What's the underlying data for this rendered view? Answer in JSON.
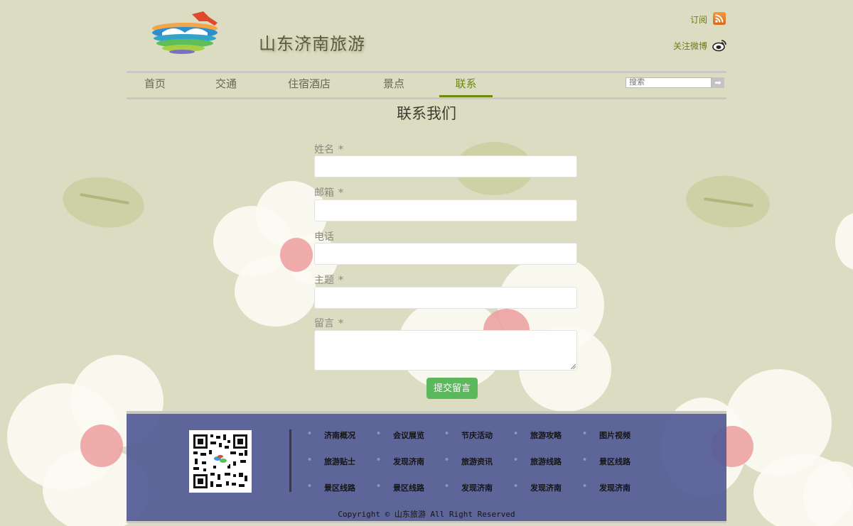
{
  "header": {
    "site_title": "山东济南旅游",
    "subscribe": "订阅",
    "follow_weibo": "关注微博",
    "logo_icon": "jinan-city-logo-icon",
    "rss_icon": "rss-icon",
    "weibo_icon": "weibo-icon"
  },
  "nav": {
    "items": [
      {
        "label": "首页",
        "active": false
      },
      {
        "label": "交通",
        "active": false
      },
      {
        "label": "住宿酒店",
        "active": false
      },
      {
        "label": "景点",
        "active": false
      },
      {
        "label": "联系",
        "active": true
      }
    ],
    "search_placeholder": "搜索",
    "search_button": "➡"
  },
  "form": {
    "title": "联系我们",
    "fields": [
      {
        "label": "姓名",
        "required": "*",
        "value": ""
      },
      {
        "label": "邮箱",
        "required": "*",
        "value": ""
      },
      {
        "label": "电话",
        "required": "",
        "value": ""
      },
      {
        "label": "主题",
        "required": "*",
        "value": ""
      },
      {
        "label": "留言",
        "required": "*",
        "value": ""
      }
    ],
    "submit": "提交留言"
  },
  "footer": {
    "links": [
      [
        "济南概况",
        "会议展览",
        "节庆活动",
        "旅游攻略",
        "图片视频"
      ],
      [
        "旅游贴士",
        "发现济南",
        "旅游资讯",
        "旅游线路",
        "景区线路"
      ],
      [
        "景区线路",
        "景区线路",
        "发现济南",
        "发现济南",
        "发现济南"
      ]
    ],
    "bullet": "•",
    "copyright": "Copyright © 山东旅游 All Right Reserved",
    "qr_icon": "qr-code-icon"
  },
  "colors": {
    "background": "#dcdcc2",
    "nav_active": "#6d8a0d",
    "footer": "#525a96",
    "submit": "#5cb85c"
  }
}
